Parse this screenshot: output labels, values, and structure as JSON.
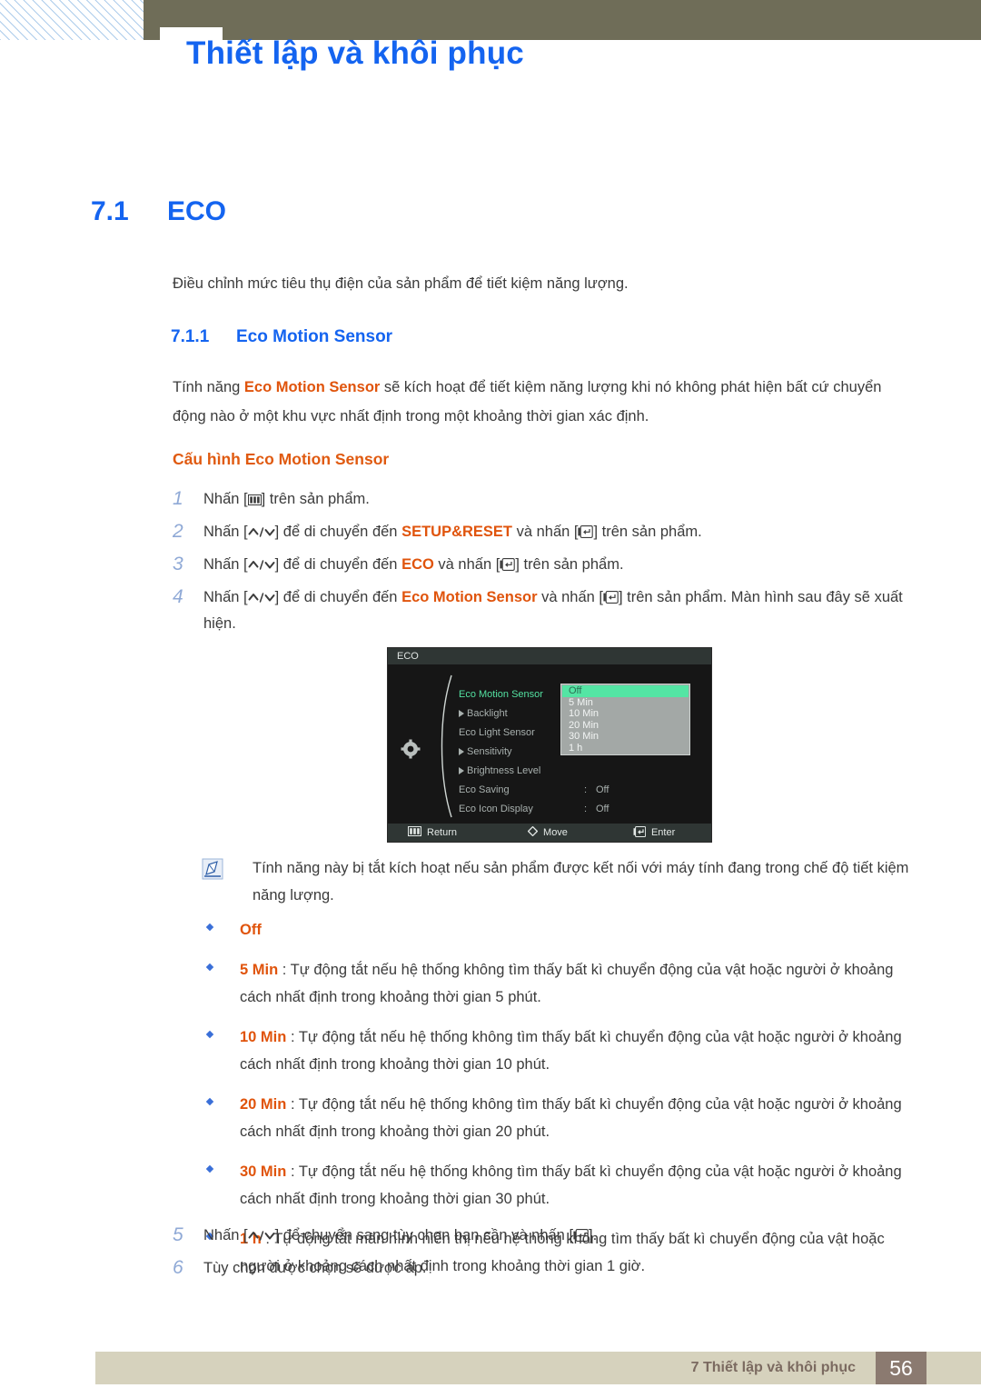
{
  "header": {
    "title": "Thiết lập và khôi phục",
    "accent_color": "#1464f0",
    "bar_color": "#6f6d58"
  },
  "section": {
    "number": "7.1",
    "title": "ECO",
    "intro": "Điều chỉnh mức tiêu thụ điện của sản phẩm để tiết kiệm năng lượng.",
    "sub_number": "7.1.1",
    "sub_title": "Eco Motion Sensor",
    "body_before": "Tính năng ",
    "body_bold": "Eco Motion Sensor",
    "body_after": " sẽ kích hoạt để tiết kiệm năng lượng khi nó không phát hiện bất cứ chuyển động nào ở một khu vực nhất định trong một khoảng thời gian xác định.",
    "config_heading": "Cấu hình Eco Motion Sensor"
  },
  "steps": [
    {
      "num": "1",
      "parts": [
        {
          "t": "Nhấn [",
          "style": "plain"
        },
        {
          "t": "menu-icon",
          "style": "icon"
        },
        {
          "t": "] trên sản phẩm.",
          "style": "plain"
        }
      ]
    },
    {
      "num": "2",
      "parts": [
        {
          "t": "Nhấn [",
          "style": "plain"
        },
        {
          "t": "updown-icon",
          "style": "icon"
        },
        {
          "t": "] để di chuyển đến ",
          "style": "plain"
        },
        {
          "t": "SETUP&RESET",
          "style": "orange"
        },
        {
          "t": " và nhấn [",
          "style": "plain"
        },
        {
          "t": "enter-icon",
          "style": "icon"
        },
        {
          "t": "] trên sản phẩm.",
          "style": "plain"
        }
      ]
    },
    {
      "num": "3",
      "parts": [
        {
          "t": "Nhấn [",
          "style": "plain"
        },
        {
          "t": "updown-icon",
          "style": "icon"
        },
        {
          "t": "] để di chuyển đến ",
          "style": "plain"
        },
        {
          "t": "ECO",
          "style": "orange"
        },
        {
          "t": " và nhấn [",
          "style": "plain"
        },
        {
          "t": "enter-icon",
          "style": "icon"
        },
        {
          "t": "] trên sản phẩm.",
          "style": "plain"
        }
      ]
    },
    {
      "num": "4",
      "parts": [
        {
          "t": "Nhấn [",
          "style": "plain"
        },
        {
          "t": "updown-icon",
          "style": "icon"
        },
        {
          "t": "] để di chuyển đến ",
          "style": "plain"
        },
        {
          "t": "Eco Motion Sensor",
          "style": "orange"
        },
        {
          "t": " và nhấn [",
          "style": "plain"
        },
        {
          "t": "enter-icon",
          "style": "icon"
        },
        {
          "t": "] trên sản phẩm. Màn hình sau đây sẽ xuất hiện.",
          "style": "plain"
        }
      ]
    }
  ],
  "steps_lower": [
    {
      "num": "5",
      "parts": [
        {
          "t": "Nhấn [",
          "style": "plain"
        },
        {
          "t": "updown-icon",
          "style": "icon"
        },
        {
          "t": "] để chuyển sang tùy chọn bạn cần và nhấn [",
          "style": "plain"
        },
        {
          "t": "enter-icon",
          "style": "icon"
        },
        {
          "t": "].",
          "style": "plain"
        }
      ]
    },
    {
      "num": "6",
      "parts": [
        {
          "t": "Tùy chọn được chọn sẽ được áp.",
          "style": "plain"
        }
      ]
    }
  ],
  "osd": {
    "title": "ECO",
    "highlight_color": "#54e5a4",
    "rows": [
      {
        "label": "Eco Motion Sensor",
        "sub": false,
        "colon": ":",
        "value": "",
        "active": true
      },
      {
        "label": "Backlight",
        "sub": true,
        "colon": "",
        "value": "",
        "active": false
      },
      {
        "label": "Eco Light Sensor",
        "sub": false,
        "colon": ":",
        "value": "",
        "active": false
      },
      {
        "label": "Sensitivity",
        "sub": true,
        "colon": "",
        "value": "",
        "active": false
      },
      {
        "label": "Brightness Level",
        "sub": true,
        "colon": "",
        "value": "",
        "active": false
      },
      {
        "label": "Eco Saving",
        "sub": false,
        "colon": ":",
        "value": "Off",
        "active": false
      },
      {
        "label": "Eco Icon Display",
        "sub": false,
        "colon": ":",
        "value": "Off",
        "active": false
      }
    ],
    "dropdown": [
      {
        "label": "Off",
        "selected": true
      },
      {
        "label": "5 Min",
        "selected": false
      },
      {
        "label": "10 Min",
        "selected": false
      },
      {
        "label": "20 Min",
        "selected": false
      },
      {
        "label": "30 Min",
        "selected": false
      },
      {
        "label": "1 h",
        "selected": false
      }
    ],
    "footer": [
      {
        "icon": "menu-icon",
        "label": "Return"
      },
      {
        "icon": "diamond-icon",
        "label": "Move"
      },
      {
        "icon": "enter-icon",
        "label": "Enter"
      }
    ]
  },
  "note": {
    "icon": "note-pencil-icon",
    "text": "Tính năng này bị tắt kích hoạt nếu sản phẩm được kết nối với máy tính đang trong chế độ tiết kiệm năng lượng."
  },
  "bullets": [
    {
      "label": "Off",
      "desc": ""
    },
    {
      "label": "5 Min",
      "desc": " : Tự động tắt nếu hệ thống không tìm thấy bất kì chuyển động của vật hoặc người ở khoảng cách nhất định trong khoảng thời gian 5 phút."
    },
    {
      "label": "10 Min",
      "desc": " : Tự động tắt nếu hệ thống không tìm thấy bất kì chuyển động của vật hoặc người ở khoảng cách nhất định trong khoảng thời gian 10 phút."
    },
    {
      "label": "20 Min",
      "desc": " : Tự động tắt nếu hệ thống không tìm thấy bất kì chuyển động của vật hoặc người ở khoảng cách nhất định trong khoảng thời gian 20 phút."
    },
    {
      "label": "30 Min",
      "desc": " : Tự động tắt nếu hệ thống không tìm thấy bất kì chuyển động của vật hoặc người ở khoảng cách nhất định trong khoảng thời gian 30 phút."
    },
    {
      "label": "1 h",
      "desc": " : Tự động tắt màn hình hiển thị nếu hệ thống không tìm thấy bất kì chuyển động của vật hoặc người ở khoảng cách nhất định trong khoảng thời gian 1 giờ."
    }
  ],
  "footer": {
    "text": "7 Thiết lập và khôi phục",
    "page": "56",
    "bar_color": "#d6d2bd",
    "page_color": "#8b7a70"
  }
}
